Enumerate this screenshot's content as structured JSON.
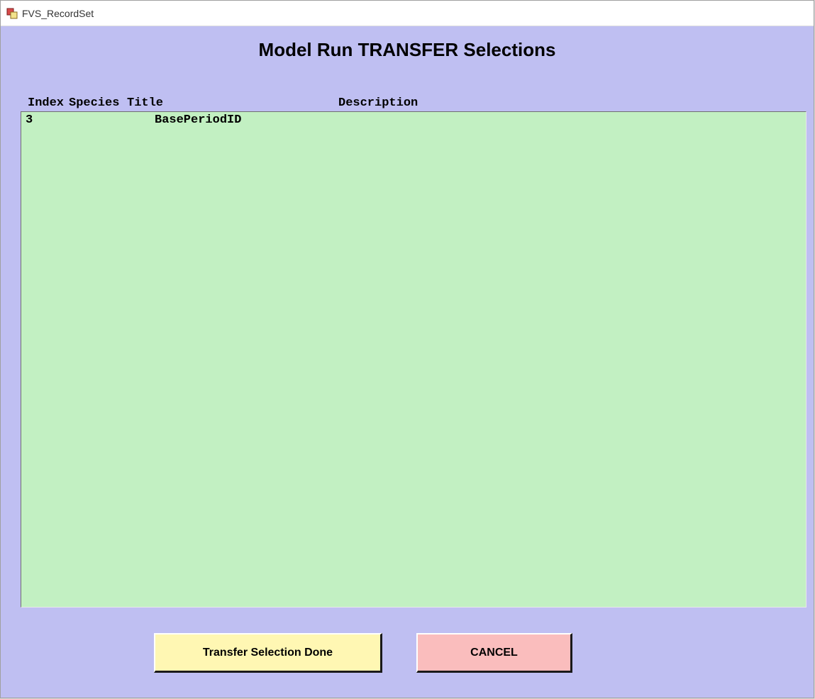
{
  "window": {
    "title": "FVS_RecordSet"
  },
  "page": {
    "title": "Model Run TRANSFER Selections"
  },
  "columns": {
    "index": "Index",
    "species": "Species",
    "title": "Title",
    "description": "Description"
  },
  "rows": [
    {
      "index": "3",
      "species": "",
      "title": "BasePeriodID",
      "description": ""
    }
  ],
  "buttons": {
    "done": "Transfer Selection Done",
    "cancel": "CANCEL"
  },
  "colors": {
    "client_bg": "#bfbff2",
    "list_bg": "#c2f0c2",
    "btn_done_bg": "#fff7b3",
    "btn_cancel_bg": "#fabdbd"
  }
}
